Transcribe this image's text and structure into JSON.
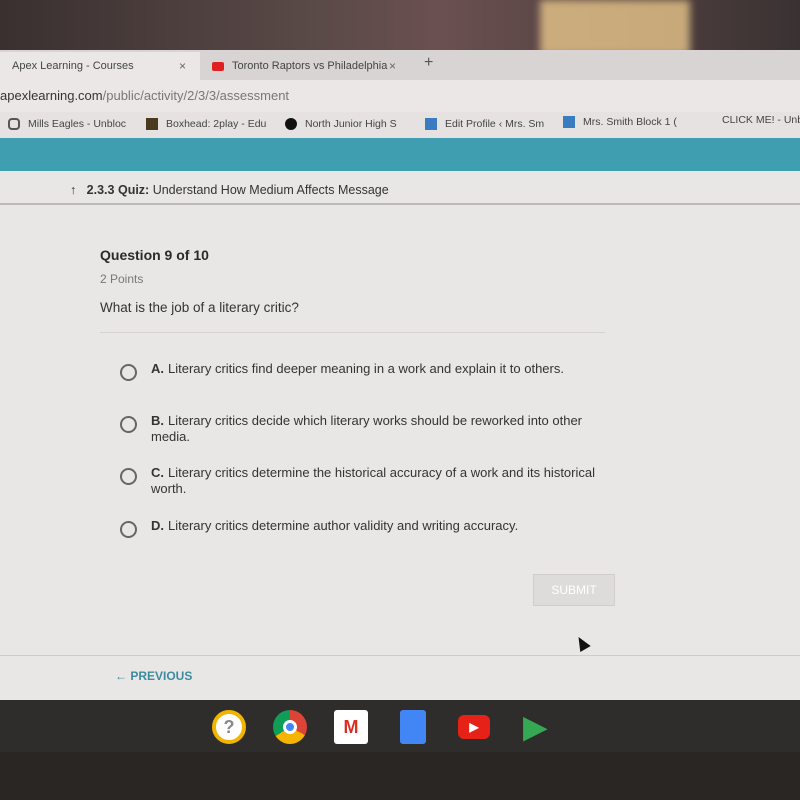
{
  "browser": {
    "tabs": [
      {
        "label": "Apex Learning - Courses",
        "active": true
      },
      {
        "label": "Toronto Raptors vs Philadelphia",
        "active": false
      }
    ],
    "close_glyph": "×",
    "new_tab_glyph": "+",
    "url_domain": "apexlearning.com",
    "url_path": "/public/activity/2/3/3/assessment",
    "bookmarks": [
      {
        "label": "Mills Eagles - Unbloc",
        "icon": "gamepad-icon"
      },
      {
        "label": "Boxhead: 2play - Edu",
        "icon": "boxhead-icon"
      },
      {
        "label": "North Junior High S",
        "icon": "school-logo-icon"
      },
      {
        "label": "Edit Profile ‹ Mrs. Sm",
        "icon": "k-icon"
      },
      {
        "label": "Mrs. Smith Block 1 (",
        "icon": "k-icon"
      },
      {
        "label": "CLICK ME! - Unb",
        "icon": ""
      }
    ]
  },
  "colors": {
    "header": "#3f9fb0",
    "link": "#3a8ca0"
  },
  "quiz": {
    "number": "2.3.3",
    "type": "Quiz:",
    "title": "Understand How Medium Affects Message"
  },
  "question": {
    "heading": "Question 9 of 10",
    "points": "2 Points",
    "text": "What is the job of a literary critic?",
    "options": [
      {
        "letter": "A.",
        "text": "Literary critics find deeper meaning in a work and explain it to others."
      },
      {
        "letter": "B.",
        "text": "Literary critics decide which literary works should be reworked into other media."
      },
      {
        "letter": "C.",
        "text": "Literary critics determine the historical accuracy of a work and its historical worth."
      },
      {
        "letter": "D.",
        "text": "Literary critics determine author validity and writing accuracy."
      }
    ],
    "selected": null
  },
  "submit_label": "SUBMIT",
  "previous_label": "← PREVIOUS",
  "taskbar": {
    "apps": [
      "help-icon",
      "chrome-icon",
      "gmail-icon",
      "docs-icon",
      "youtube-icon",
      "play-store-icon"
    ],
    "help_glyph": "?"
  }
}
